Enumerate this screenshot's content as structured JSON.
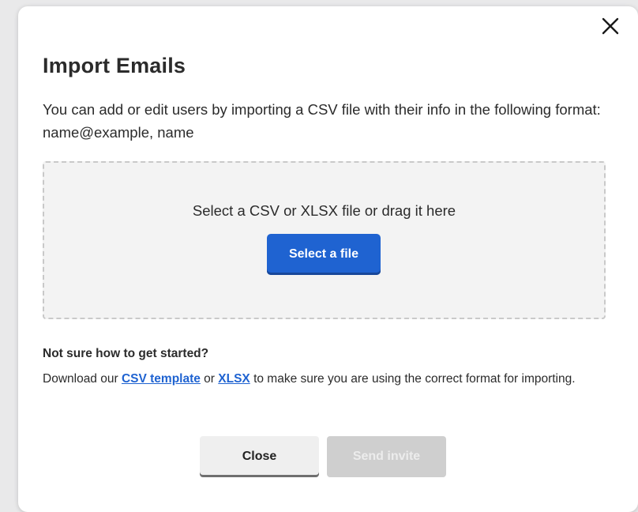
{
  "dialog": {
    "title": "Import Emails",
    "description": "You can add or edit users by importing a CSV file with their info in the following format: name@example, name"
  },
  "dropzone": {
    "prompt": "Select a CSV or XLSX file or drag it here",
    "select_button": "Select a file"
  },
  "help": {
    "heading": "Not sure how to get started?",
    "text_prefix": "Download our ",
    "csv_link": "CSV template",
    "text_middle": " or ",
    "xlsx_link": "XLSX",
    "text_suffix": " to make sure you are using the correct format for importing."
  },
  "footer": {
    "close_label": "Close",
    "send_label": "Send invite",
    "send_disabled": true
  },
  "icons": {
    "close": "close-icon"
  },
  "colors": {
    "primary": "#1f63d1",
    "text": "#2b2b2b",
    "dropzone_bg": "#f3f3f3",
    "disabled_bg": "#cfcfcf"
  }
}
